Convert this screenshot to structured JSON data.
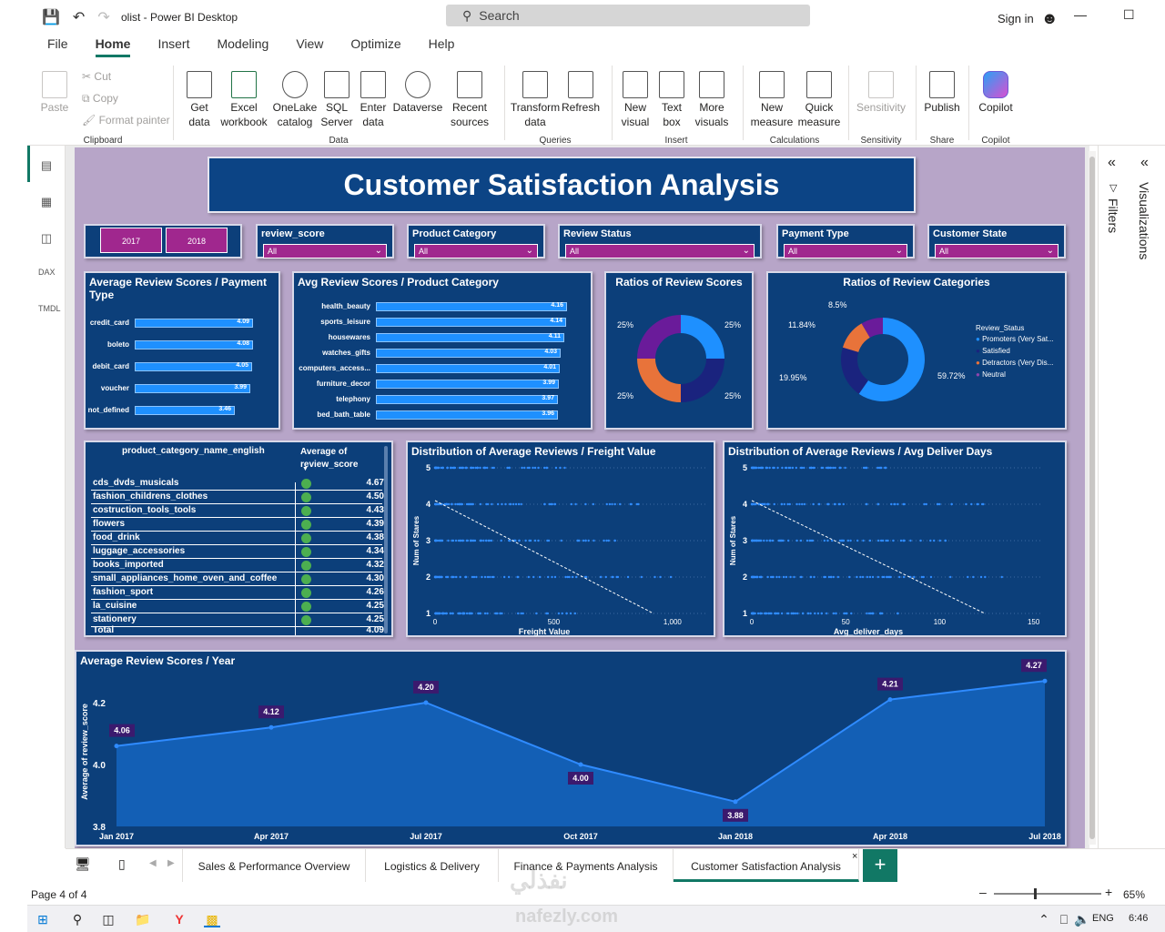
{
  "window": {
    "title": "olist - Power BI Desktop",
    "search_label": "Search",
    "signin": "Sign in"
  },
  "menu": [
    "File",
    "Home",
    "Insert",
    "Modeling",
    "View",
    "Optimize",
    "Help"
  ],
  "ribbon": {
    "clipboard": {
      "paste": "Paste",
      "cut": "Cut",
      "copy": "Copy",
      "format": "Format painter",
      "label": "Clipboard"
    },
    "data": {
      "items": [
        "Get data",
        "Excel workbook",
        "OneLake catalog",
        "SQL Server",
        "Enter data",
        "Dataverse",
        "Recent sources"
      ],
      "label": "Data"
    },
    "queries": {
      "items": [
        "Transform data",
        "Refresh"
      ],
      "label": "Queries"
    },
    "insert": {
      "items": [
        "New visual",
        "Text box",
        "More visuals"
      ],
      "label": "Insert"
    },
    "calculations": {
      "items": [
        "New measure",
        "Quick measure"
      ],
      "label": "Calculations"
    },
    "sensitivity": {
      "items": [
        "Sensitivity"
      ],
      "label": "Sensitivity"
    },
    "share": {
      "items": [
        "Publish"
      ],
      "label": "Share"
    },
    "copilot": {
      "items": [
        "Copilot"
      ],
      "label": "Copilot"
    }
  },
  "panes": {
    "filters": "Filters",
    "visualizations": "Visualizations"
  },
  "report": {
    "title": "Customer Satisfaction Analysis",
    "years": [
      "2017",
      "2018"
    ],
    "slicers": [
      {
        "title": "review_score",
        "value": "All"
      },
      {
        "title": "Product Category",
        "value": "All"
      },
      {
        "title": "Review Status",
        "value": "All"
      },
      {
        "title": "Payment Type",
        "value": "All"
      },
      {
        "title": "Customer State",
        "value": "All"
      }
    ],
    "donut_labels": {
      "tl": "25%",
      "tr": "25%",
      "bl": "25%",
      "br": "25%"
    },
    "pie_labels": {
      "a": "8.5%",
      "b": "11.84%",
      "c": "19.95%",
      "d": "59.72%"
    },
    "table": {
      "col1": "product_category_name_english",
      "col2": "Average of review_score",
      "rows": [
        {
          "name": "cds_dvds_musicals",
          "value": "4.67"
        },
        {
          "name": "fashion_childrens_clothes",
          "value": "4.50"
        },
        {
          "name": "costruction_tools_tools",
          "value": "4.43"
        },
        {
          "name": "flowers",
          "value": "4.39"
        },
        {
          "name": "food_drink",
          "value": "4.38"
        },
        {
          "name": "luggage_accessories",
          "value": "4.34"
        },
        {
          "name": "books_imported",
          "value": "4.32"
        },
        {
          "name": "small_appliances_home_oven_and_coffee",
          "value": "4.30"
        },
        {
          "name": "fashion_sport",
          "value": "4.26"
        },
        {
          "name": "la_cuisine",
          "value": "4.25"
        },
        {
          "name": "stationery",
          "value": "4.25"
        }
      ],
      "total_label": "Total",
      "total_value": "4.09"
    }
  },
  "tabs": [
    "Sales & Performance Overview",
    "Logistics & Delivery",
    "Finance & Payments Analysis",
    "Customer Satisfaction Analysis"
  ],
  "status": {
    "page": "Page 4 of 4",
    "zoom": "65%"
  },
  "taskbar": {
    "lang": "ENG",
    "time": "6:46"
  },
  "chart_data": [
    {
      "type": "bar",
      "title": "Average Review Scores / Payment Type",
      "categories": [
        "credit_card",
        "boleto",
        "debit_card",
        "voucher",
        "not_defined"
      ],
      "values": [
        4.09,
        4.08,
        4.05,
        3.99,
        3.46
      ],
      "labels": [
        "4.09",
        "4.08",
        "4.05",
        "3.99",
        "3.46"
      ]
    },
    {
      "type": "bar",
      "title": "Avg Review Scores / Product Category",
      "categories": [
        "health_beauty",
        "sports_leisure",
        "housewares",
        "watches_gifts",
        "computers_access...",
        "furniture_decor",
        "telephony",
        "bed_bath_table"
      ],
      "values": [
        4.16,
        4.14,
        4.11,
        4.03,
        4.01,
        3.99,
        3.97,
        3.96
      ],
      "labels": [
        "4.16",
        "4.14",
        "4.11",
        "4.03",
        "4.01",
        "3.99",
        "3.97",
        "3.96"
      ]
    },
    {
      "type": "pie",
      "title": "Ratios of Review Scores",
      "values": [
        25,
        25,
        25,
        25
      ],
      "colors": [
        "#1e90ff",
        "#1a237e",
        "#e8733a",
        "#6a1b9a"
      ]
    },
    {
      "type": "pie",
      "title": "Ratios of Review Categories",
      "legend_title": "Review_Status",
      "series": [
        {
          "name": "Promoters (Very Sat...",
          "value": 59.72,
          "color": "#1e90ff"
        },
        {
          "name": "Satisfied",
          "value": 19.95,
          "color": "#1a237e"
        },
        {
          "name": "Detractors (Very Dis...",
          "value": 11.84,
          "color": "#e8733a"
        },
        {
          "name": "Neutral",
          "value": 8.5,
          "color": "#6a1b9a"
        }
      ]
    },
    {
      "type": "scatter",
      "title": "Distribution of Average Reviews / Freight Value",
      "xlabel": "Freight Value",
      "ylabel": "Num of Stares",
      "xlim": [
        0,
        1150
      ],
      "ylim": [
        1,
        5
      ],
      "xticks": [
        "0",
        "500",
        "1,000"
      ],
      "xtick_values": [
        0,
        500,
        1000
      ],
      "yticks": [
        "1",
        "2",
        "3",
        "4",
        "5"
      ]
    },
    {
      "type": "scatter",
      "title": "Distribution of Average Reviews / Avg Deliver Days",
      "xlabel": "Avg_deliver_days",
      "ylabel": "Num of Stares",
      "xlim": [
        0,
        155
      ],
      "ylim": [
        1,
        5
      ],
      "xticks": [
        "0",
        "50",
        "100",
        "150"
      ],
      "xtick_values": [
        0,
        50,
        100,
        150
      ],
      "yticks": [
        "1",
        "2",
        "3",
        "4",
        "5"
      ]
    },
    {
      "type": "area",
      "title": "Average Review Scores / Year",
      "ylabel": "Average of review_score",
      "x": [
        "Jan 2017",
        "Apr 2017",
        "Jul 2017",
        "Oct 2017",
        "Jan 2018",
        "Apr 2018",
        "Jul 2018"
      ],
      "values": [
        4.06,
        4.12,
        4.2,
        4.0,
        3.88,
        4.21,
        4.27
      ],
      "labels": [
        "4.06",
        "4.12",
        "4.20",
        "4.00",
        "3.88",
        "4.21",
        "4.27"
      ],
      "ylim": [
        3.8,
        4.3
      ],
      "yticks": [
        "3.8",
        "4.0",
        "4.2"
      ],
      "ytick_values": [
        3.8,
        4.0,
        4.2
      ]
    }
  ]
}
